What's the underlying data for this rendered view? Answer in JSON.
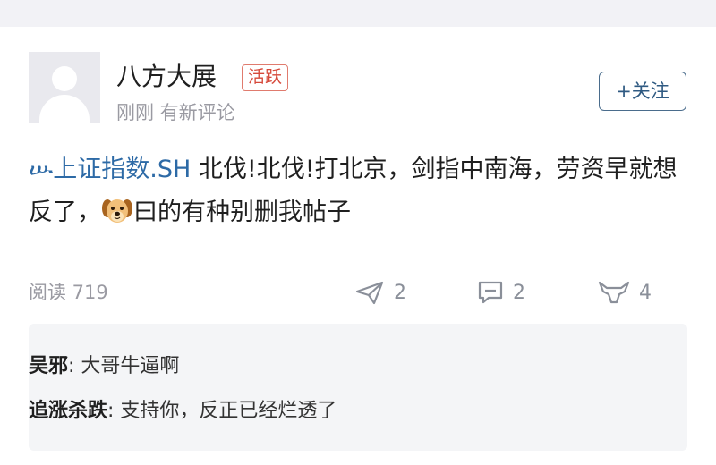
{
  "post": {
    "author": {
      "name": "八方大展",
      "badge": "活跃",
      "subtitle": "刚刚 有新评论"
    },
    "follow_label": "+关注",
    "stock_tag": "上证指数.SH",
    "text_part1": "北伐!北伐!打北京，剑指中南海，劳资早就想反了，",
    "text_part2": "曰的有种别删我帖子",
    "emoji": "dog-face-emoji",
    "stats": {
      "read_label": "阅读 719",
      "shares": "2",
      "comments": "2",
      "likes": "4"
    }
  },
  "comments": [
    {
      "author": "吴邪",
      "separator": ": ",
      "text": "大哥牛逼啊"
    },
    {
      "author": "追涨杀跌",
      "separator": ": ",
      "text": "支持你，反正已经烂透了"
    }
  ],
  "colors": {
    "link": "#2d6aa6",
    "badge": "#d6493a",
    "follow_border": "#4a6c8c",
    "comment_bg": "#f4f5f7"
  },
  "icons": [
    "stock-tag-icon",
    "share-icon",
    "comment-icon",
    "like-icon",
    "dog-face-emoji"
  ]
}
